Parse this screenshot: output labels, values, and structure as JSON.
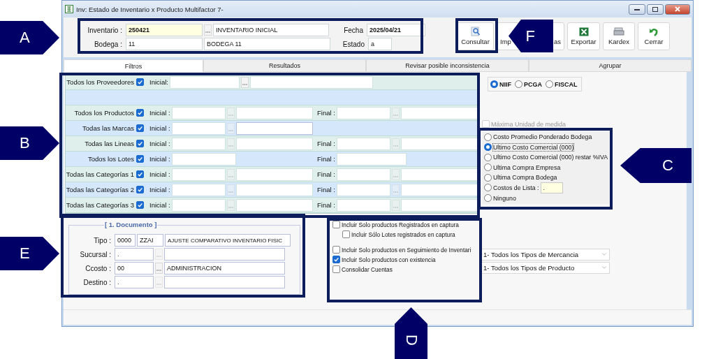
{
  "window": {
    "title": "Inv: Estado de Inventario x Producto Multifactor 7-"
  },
  "header": {
    "inventario_label": "Inventario :",
    "inventario_code": "250421",
    "inventario_name": "INVENTARIO INICIAL",
    "bodega_label": "Bodega :",
    "bodega_code": "11",
    "bodega_name": "BODEGA 11",
    "fecha_label": "Fecha",
    "fecha": "2025/04/21",
    "estado_label": "Estado",
    "estado": "a"
  },
  "toolbar": [
    {
      "label": "Consultar",
      "kind": "search"
    },
    {
      "label": "Imp",
      "kind": "hidden-left"
    },
    {
      "label": "as",
      "kind": "hidden-right"
    },
    {
      "label": "Exportar",
      "kind": "excel"
    },
    {
      "label": "Kardex",
      "kind": "kardex"
    },
    {
      "label": "Cerrar",
      "kind": "close"
    }
  ],
  "tabs": [
    {
      "label": "Filtros",
      "selected": true
    },
    {
      "label": "Resultados",
      "selected": false
    },
    {
      "label": "Revisar posible inconsistencia",
      "selected": false
    },
    {
      "label": "Agrupar",
      "selected": false
    }
  ],
  "filters": [
    {
      "label": "Todos los Proveedores",
      "checked": true,
      "kind": "wide",
      "initial_label": "Inicial:"
    },
    {
      "label": "Todos los Productos",
      "checked": true,
      "kind": "range",
      "initial_label": "Inicial :",
      "final_label": "Final :"
    },
    {
      "label": "Todas las Marcas",
      "checked": true,
      "kind": "single",
      "initial_label": "Inicial :"
    },
    {
      "label": "Todas las Lineas",
      "checked": true,
      "kind": "range",
      "initial_label": "Inicial :",
      "final_label": "Final :"
    },
    {
      "label": "Todos los Lotes",
      "checked": true,
      "kind": "plain-range",
      "initial_label": "Inicial :",
      "final_label": "Final :"
    },
    {
      "label": "Todas las Categorías 1",
      "checked": true,
      "kind": "range",
      "initial_label": "Inicial :",
      "final_label": "Final :"
    },
    {
      "label": "Todas las Categorías 2",
      "checked": true,
      "kind": "range",
      "initial_label": "Inicial :",
      "final_label": "Final :"
    },
    {
      "label": "Todas las Categorías 3",
      "checked": true,
      "kind": "range",
      "initial_label": "Inicial :",
      "final_label": "Final :"
    }
  ],
  "document": {
    "title": "[ 1. Documento ]",
    "rows": [
      {
        "label": "Tipo :",
        "kind": "triple",
        "code": "0000",
        "code2": "ZZAI",
        "name": "AJUSTE COMPARATIVO INVENTARIO FISIC"
      },
      {
        "label": "Sucursal :",
        "kind": "lookup",
        "code": ".",
        "lookup_disabled": true
      },
      {
        "label": "Ccosto :",
        "kind": "lookup",
        "code": "00",
        "name": "ADMINISTRACION",
        "lookup_disabled": false
      },
      {
        "label": "Destino :",
        "kind": "lookup",
        "code": ".",
        "lookup_disabled": true
      }
    ]
  },
  "options": [
    {
      "label": "Incluir Solo productos Registrados en captura",
      "checked": false,
      "children": [
        {
          "label": "Incluir Sólo Lotes registrados en captura",
          "checked": false
        }
      ]
    },
    {
      "label": "Incluir Solo productos en Seguimiento de Inventari",
      "checked": false
    },
    {
      "label": "Incluir Solo productos con existencia",
      "checked": true
    },
    {
      "label": "Consolidar Cuentas",
      "checked": false
    }
  ],
  "norms": [
    {
      "label": "NIIF",
      "selected": true
    },
    {
      "label": "PCGA",
      "selected": false
    },
    {
      "label": "FISCAL",
      "selected": false
    }
  ],
  "max_unit": {
    "label": "Máxima Unidad de medida",
    "checked": false,
    "disabled": true
  },
  "cost_methods": [
    {
      "label": "Costo Promedio Ponderado Bodega",
      "selected": false,
      "kind": "plain"
    },
    {
      "label": "Ultimo Costo Comercial (000)",
      "selected": true,
      "kind": "plain"
    },
    {
      "label": "Ultimo Costo Comercial (000)  restar %IVA",
      "selected": false,
      "kind": "plain"
    },
    {
      "label": "Ultima Compra Empresa",
      "selected": false,
      "kind": "plain"
    },
    {
      "label": "Ultima Compra Bodega",
      "selected": false,
      "kind": "plain"
    },
    {
      "label": "Costos de Lista :",
      "selected": false,
      "kind": "field",
      "value": "."
    },
    {
      "label": "Ninguno",
      "selected": false,
      "kind": "plain"
    }
  ],
  "selects": [
    "1-  Todos los Tipos de Mercancia",
    "1-  Todos los Tipos de Producto"
  ],
  "callouts": [
    {
      "letter": "A"
    },
    {
      "letter": "F"
    },
    {
      "letter": "B"
    },
    {
      "letter": "C"
    },
    {
      "letter": "E"
    },
    {
      "letter": "D"
    }
  ]
}
